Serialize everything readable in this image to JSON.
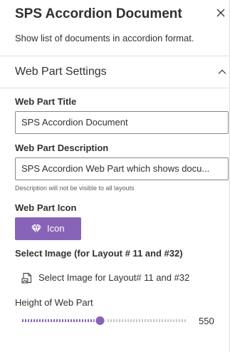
{
  "panel": {
    "title": "SPS Accordion Document",
    "description": "Show list of documents in accordion format.",
    "close_icon": "close-icon"
  },
  "accordion": {
    "label": "Web Part Settings",
    "expanded": true,
    "chevron_icon": "chevron-up-icon"
  },
  "fields": {
    "title_label": "Web Part Title",
    "title_value": "SPS Accordion Document",
    "description_label": "Web Part Description",
    "description_value": "SPS Accordion Web Part which shows docu...",
    "description_hint": "Description will not be visible to all layouts",
    "icon_label": "Web Part Icon",
    "icon_button_label": "Icon",
    "icon_button_icon": "diamond-icon",
    "select_image_label": "Select Image (for Layout # 11 and #32)",
    "select_image_link": "Select Image for Layout# 11 and #32",
    "select_image_icon": "image-file-icon",
    "height_label": "Height of Web Part",
    "height_value": "550",
    "height_fraction": 0.47
  },
  "colors": {
    "accent": "#8764b8",
    "slider_rail": "#c8c6c4",
    "text": "#323130",
    "border": "#8a8886"
  }
}
